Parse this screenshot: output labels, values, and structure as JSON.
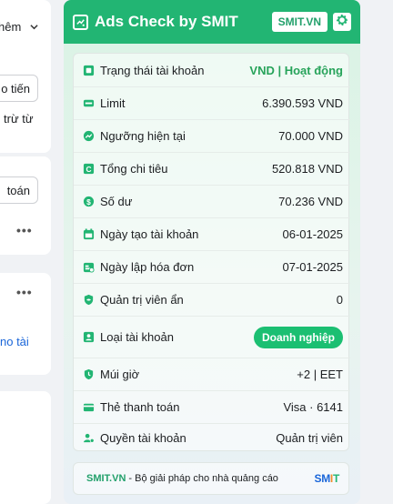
{
  "background": {
    "select_text": "hêm",
    "button1": "o tiến",
    "text1": "trừ từ",
    "button2": "toán",
    "dots": "•••",
    "link_text": "no tài"
  },
  "panel": {
    "title": "Ads Check by SMIT",
    "brand": "SMIT.VN",
    "accent_color": "#22b573",
    "rows": [
      {
        "icon": "account-status-icon",
        "label": "Trạng thái tài khoản",
        "value": "VND | Hoạt động",
        "style": "green"
      },
      {
        "icon": "limit-icon",
        "label": "Limit",
        "value": "6.390.593 VND"
      },
      {
        "icon": "threshold-icon",
        "label": "Ngưỡng hiện tại",
        "value": "70.000 VND"
      },
      {
        "icon": "spend-icon",
        "label": "Tổng chi tiêu",
        "value": "520.818 VND"
      },
      {
        "icon": "balance-icon",
        "label": "Số dư",
        "value": "70.236 VND"
      },
      {
        "icon": "calendar-icon",
        "label": "Ngày tạo tài khoản",
        "value": "06-01-2025"
      },
      {
        "icon": "invoice-icon",
        "label": "Ngày lập hóa đơn",
        "value": "07-01-2025"
      },
      {
        "icon": "hidden-admin-icon",
        "label": "Quản trị viên ẩn",
        "value": "0"
      },
      {
        "icon": "account-type-icon",
        "label": "Loại tài khoản",
        "value": "Doanh nghiệp",
        "style": "badge"
      },
      {
        "icon": "timezone-icon",
        "label": "Múi giờ",
        "value": "+2 | EET"
      },
      {
        "icon": "card-icon",
        "label": "Thẻ thanh toán",
        "value": "Visa · 6141"
      },
      {
        "icon": "account-role-icon",
        "label": "Quyền tài khoản",
        "value": "Quản trị viên"
      }
    ],
    "footer": {
      "link": "SMIT.VN",
      "text": "- Bộ giải pháp cho nhà quảng cáo",
      "logo": [
        "SM",
        "I",
        "T"
      ]
    }
  }
}
